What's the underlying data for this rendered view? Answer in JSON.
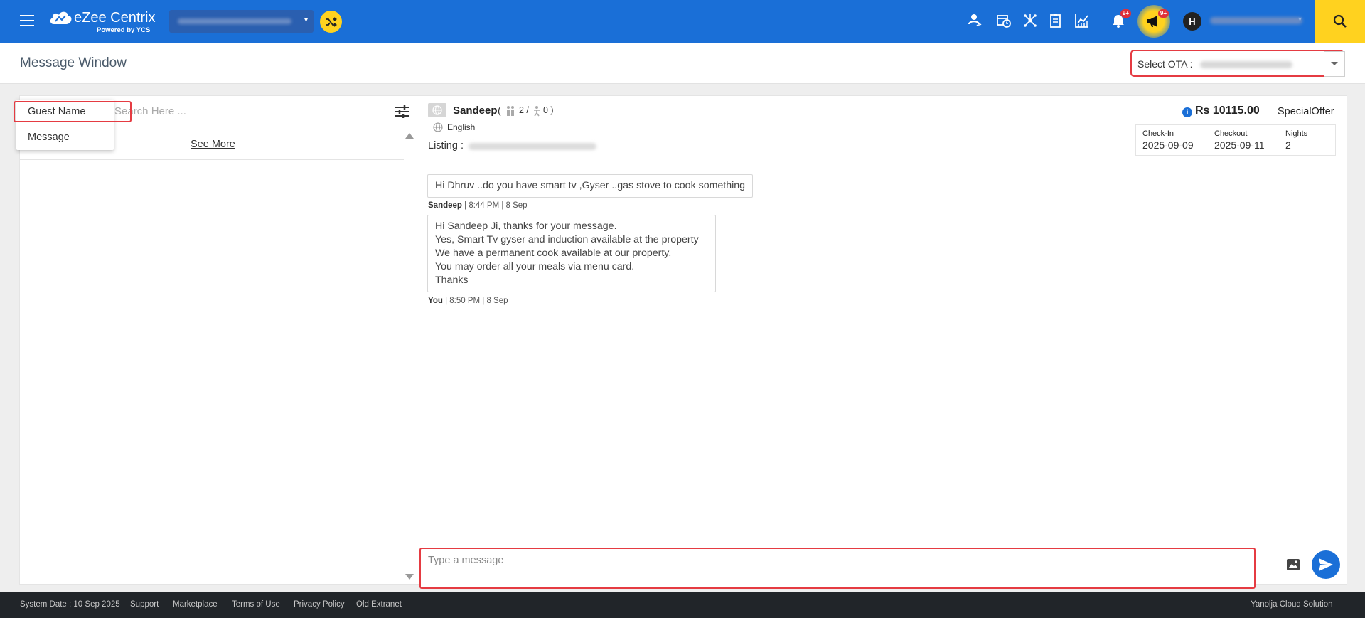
{
  "app": {
    "logo_text": "eZee Centrix",
    "logo_sub": "Powered by YCS",
    "notification_badge": "9+",
    "announcement_badge": "9+",
    "avatar_initial": "H",
    "colors": {
      "primary": "#1a6fd7",
      "accent": "#ffd21f",
      "highlight": "#e53b42",
      "footer": "#212529"
    },
    "icons": [
      "menu-icon",
      "shuffle-icon",
      "guest-icon",
      "calendar-clock-icon",
      "network-icon",
      "clipboard-icon",
      "chart-icon",
      "bell-icon",
      "megaphone-icon",
      "search-icon"
    ]
  },
  "page": {
    "title": "Message Window",
    "ota_label": "Select OTA :"
  },
  "left": {
    "search_placeholder": "Search Here ...",
    "see_more": "See More",
    "dropdown": [
      "Guest Name",
      "Message"
    ]
  },
  "conversation": {
    "guest_name": "Sandeep",
    "paren_open": "(",
    "adults": "2 /",
    "children": "0 )",
    "language": "English",
    "listing_label": "Listing :",
    "price": "Rs 10115.00",
    "offer": "SpecialOffer",
    "checkin_label": "Check-In",
    "checkin_value": "2025-09-09",
    "checkout_label": "Checkout",
    "checkout_value": "2025-09-11",
    "nights_label": "Nights",
    "nights_value": "2"
  },
  "messages": [
    {
      "lines": [
        "Hi Dhruv ..do you have smart tv ,Gyser ..gas stove to cook something"
      ],
      "sender": "Sandeep",
      "meta": " | 8:44 PM | 8 Sep"
    },
    {
      "lines": [
        "Hi Sandeep Ji, thanks for your message.",
        "Yes, Smart Tv gyser and induction available at the property",
        "We have a permanent cook available at our property.",
        "You may order all your meals via menu card.",
        "Thanks"
      ],
      "sender": "You",
      "meta": " | 8:50 PM | 8 Sep"
    }
  ],
  "compose": {
    "placeholder": "Type a message"
  },
  "footer": {
    "system_date": "System Date : 10 Sep 2025",
    "support": "Support",
    "marketplace": "Marketplace",
    "terms": "Terms of Use",
    "privacy": "Privacy Policy",
    "old_extranet": "Old Extranet",
    "brand": "Yanolja Cloud Solution"
  }
}
